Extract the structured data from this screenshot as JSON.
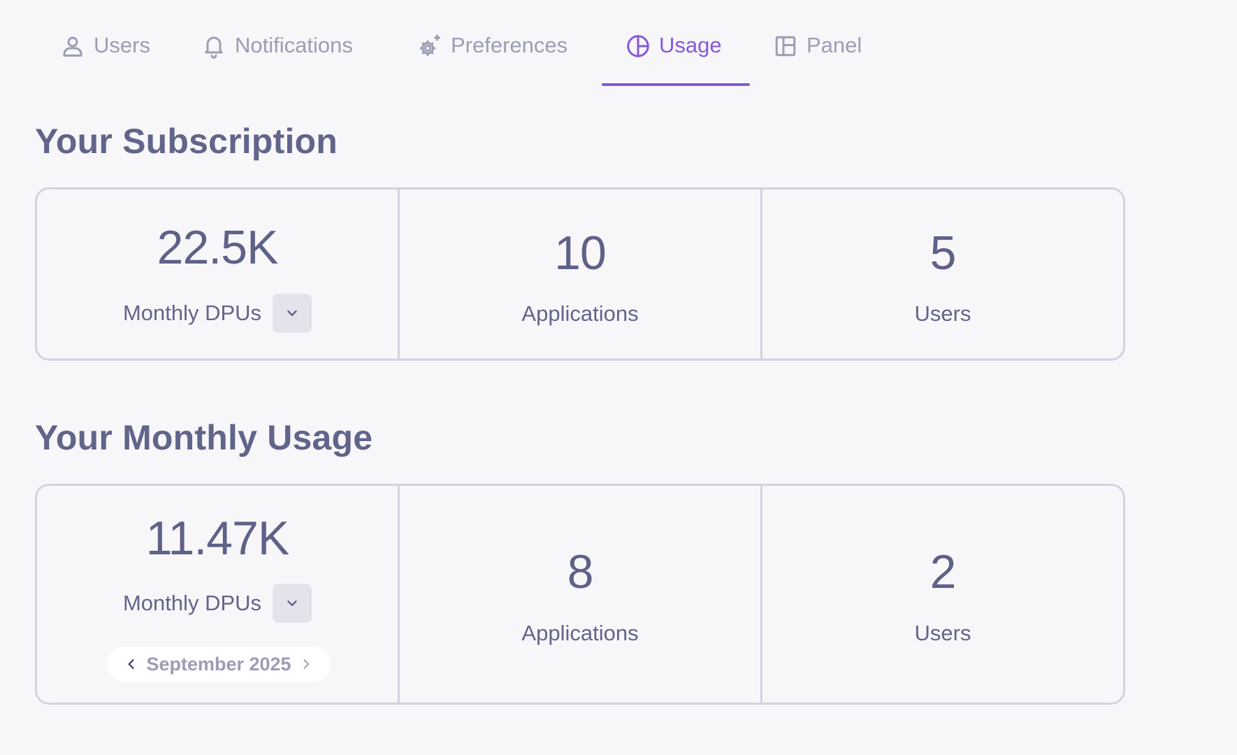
{
  "tabs": [
    {
      "label": "Users",
      "icon": "user-icon"
    },
    {
      "label": "Notifications",
      "icon": "bell-icon"
    },
    {
      "label": "Preferences",
      "icon": "gear-sparkle-icon"
    },
    {
      "label": "Usage",
      "icon": "pie-chart-icon",
      "active": true
    },
    {
      "label": "Panel",
      "icon": "layout-panel-icon"
    }
  ],
  "subscription": {
    "title": "Your Subscription",
    "dpus_value": "22.5K",
    "dpus_label": "Monthly DPUs",
    "applications_value": "10",
    "applications_label": "Applications",
    "users_value": "5",
    "users_label": "Users"
  },
  "usage": {
    "title": "Your Monthly Usage",
    "dpus_value": "11.47K",
    "dpus_label": "Monthly DPUs",
    "month": "September 2025",
    "applications_value": "8",
    "applications_label": "Applications",
    "users_value": "2",
    "users_label": "Users"
  },
  "colors": {
    "accent": "#8757e0",
    "text": "#62648a",
    "muted": "#9c9db5",
    "border": "#d2d3e0",
    "background": "#f7f7fa"
  }
}
